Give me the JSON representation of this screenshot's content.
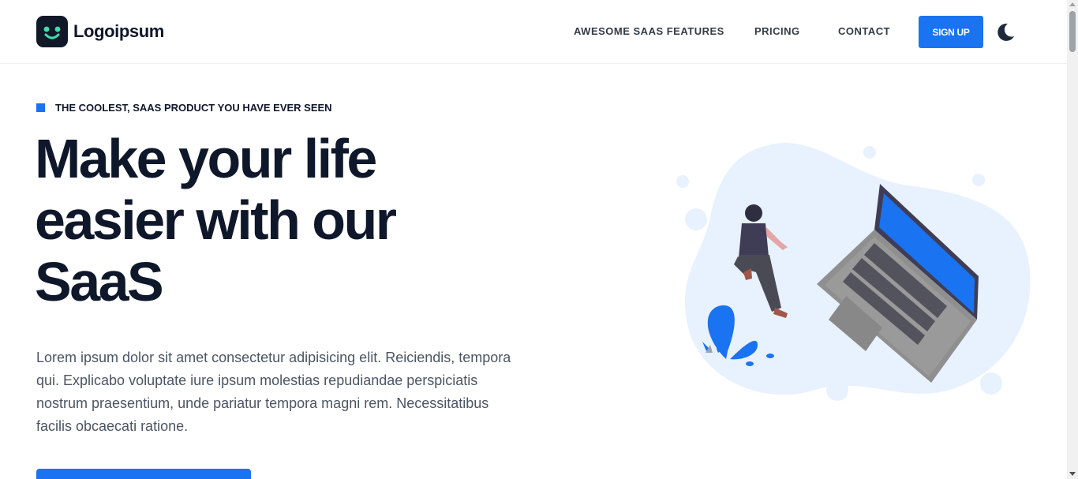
{
  "header": {
    "logo_text": "Logoipsum",
    "nav": [
      {
        "label": "AWESOME SAAS FEATURES"
      },
      {
        "label": "PRICING"
      },
      {
        "label": "CONTACT"
      }
    ],
    "signup_label": "SIGN UP",
    "theme_icon": "moon-icon"
  },
  "hero": {
    "eyebrow": "THE COOLEST, SAAS PRODUCT YOU HAVE EVER SEEN",
    "title": "Make your life easier with our SaaS",
    "description": "Lorem ipsum dolor sit amet consectetur adipisicing elit. Reiciendis, tempora qui. Explicabo voluptate iure ipsum molestias repudiandae perspiciatis nostrum praesentium, unde pariatur tempora magni rem. Necessitatibus facilis obcaecati ratione."
  },
  "colors": {
    "accent": "#1a73f0",
    "heading": "#0f172a",
    "body_text": "#4b5563",
    "blob": "#e8f1fe"
  }
}
